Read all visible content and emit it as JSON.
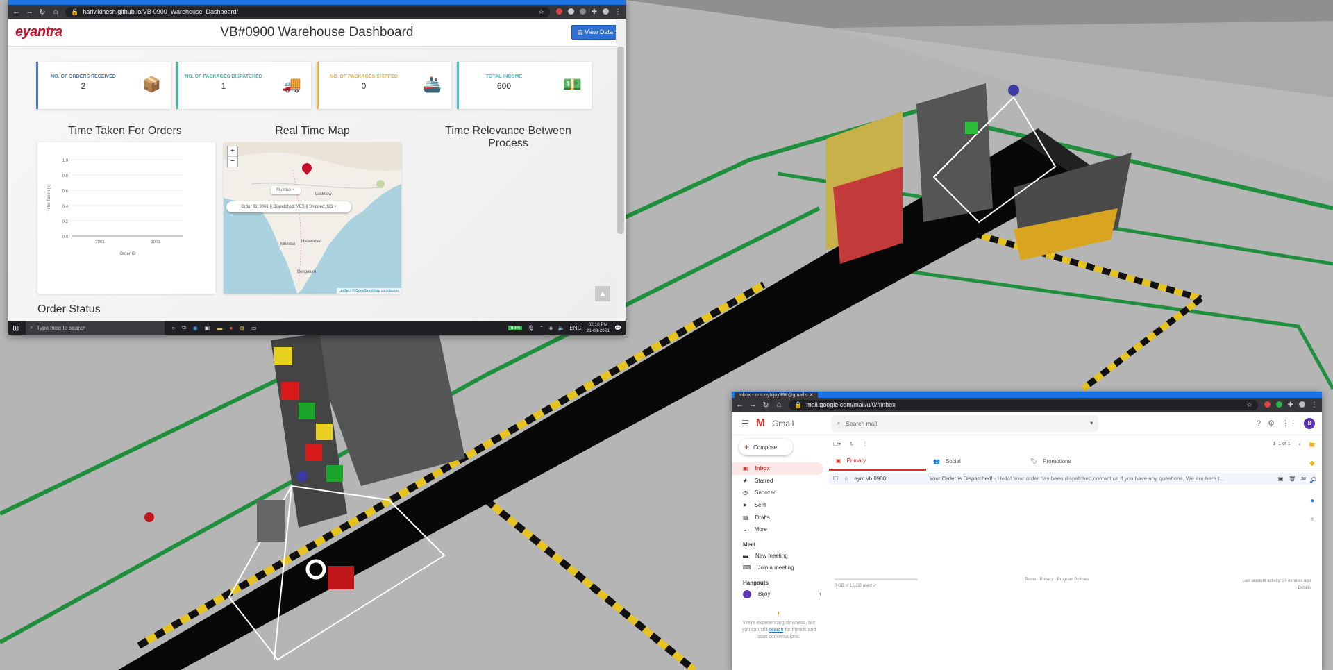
{
  "dashboard_browser": {
    "url_host": "harivikinesh.github.io",
    "url_path": "/VB-0900_Warehouse_Dashboard/",
    "logo": "eyantra",
    "title": "VB#0900 Warehouse Dashboard",
    "view_data": "View Data",
    "cards": [
      {
        "label": "NO. OF ORDERS RECEIVED",
        "value": "2",
        "color": "#4a7ab8",
        "icon": "package-icon"
      },
      {
        "label": "NO. OF PACKAGES DISPATCHED",
        "value": "1",
        "color": "#43b89d",
        "icon": "truck-icon"
      },
      {
        "label": "NO. OF PACKAGES SHIPPED",
        "value": "0",
        "color": "#e0b64a",
        "icon": "ship-icon"
      },
      {
        "label": "TOTAL INCOME",
        "value": "600",
        "color": "#45c3d3",
        "icon": "money-icon"
      }
    ],
    "section_titles": {
      "time_taken": "Time Taken For Orders",
      "map": "Real Time Map",
      "relevance": "Time Relevance Between Process"
    },
    "chart_data": {
      "type": "bar",
      "categories": [
        "3001",
        "1001"
      ],
      "values": [
        0,
        0
      ],
      "title": "",
      "xlabel": "Order ID",
      "ylabel": "Time Taken (s)",
      "ylim": [
        0,
        1.0
      ],
      "yticks": [
        "1.0",
        "0.8",
        "0.6",
        "0.4",
        "0.2",
        "0.0"
      ]
    },
    "map": {
      "zoom_in": "+",
      "zoom_out": "−",
      "city_labels": [
        "Lucknow",
        "Mumbai",
        "Hyderabad",
        "Bengaluru"
      ],
      "popup_small": "Mumbai",
      "popup_main": "Order ID: 3001 || Dispatched: YES || Shipped: NO",
      "attribution": "Leaflet | © OpenStreetMap contributors"
    },
    "order_status": "Order Status"
  },
  "taskbar": {
    "search_placeholder": "Type here to search",
    "battery": "98%",
    "lang": "ENG",
    "time": "02:10 PM",
    "date": "21-03-2021"
  },
  "gmail_browser": {
    "tab_title": "Inbox - antonybijoy398@gmail.c",
    "url_host": "mail.google.com",
    "url_path": "/mail/u/0/#inbox",
    "brand": "Gmail",
    "search_placeholder": "Search mail",
    "compose": "Compose",
    "nav": [
      {
        "label": "Inbox",
        "icon": "inbox-icon",
        "glyph": "▣",
        "active": true
      },
      {
        "label": "Starred",
        "icon": "star-icon",
        "glyph": "★"
      },
      {
        "label": "Snoozed",
        "icon": "clock-icon",
        "glyph": "◷"
      },
      {
        "label": "Sent",
        "icon": "send-icon",
        "glyph": "➤"
      },
      {
        "label": "Drafts",
        "icon": "draft-icon",
        "glyph": "▤"
      },
      {
        "label": "More",
        "icon": "chevron-down-icon",
        "glyph": "⌄"
      }
    ],
    "meet_title": "Meet",
    "meet_items": [
      "New meeting",
      "Join a meeting"
    ],
    "hangouts_title": "Hangouts",
    "hangouts_user": "Bijoy",
    "slowness": "We're experiencing slowness, but you can still",
    "slowness_link": "search",
    "slowness_tail": "for friends and start conversations.",
    "pagination": "1–1 of 1",
    "tabs": [
      "Primary",
      "Social",
      "Promotions"
    ],
    "email_sender": "eyrc.vb.0900",
    "email_subject": "Your Order is Dispatched!",
    "email_snippet": " - Hello! Your order has been dispatched,contact us if you have any questions. We are here t...",
    "storage": "0 GB of 15 GB used",
    "footer_links": "Terms · Privacy · Program Policies",
    "last_activity": "Last account activity: 24 minutes ago",
    "details": "Details",
    "avatar_letter": "B"
  }
}
